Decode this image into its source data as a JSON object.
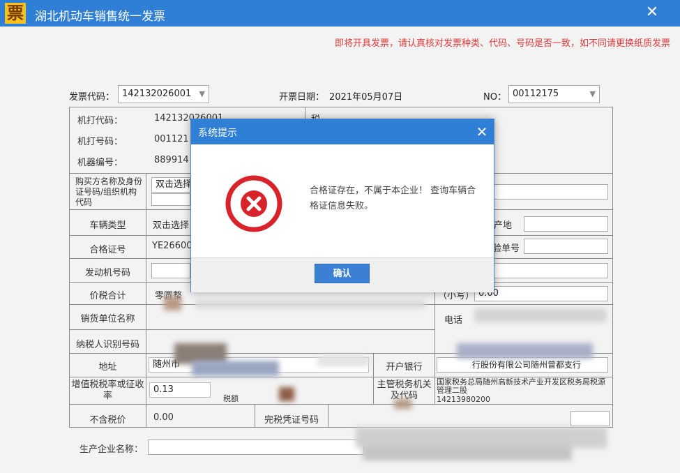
{
  "window": {
    "icon_glyph": "票",
    "title": "湖北机动车销售统一发票",
    "close_glyph": "✕"
  },
  "warning": "即将开具发票，请认真核对发票种类、代码、号码是否一致，如不同请更换纸质发票",
  "header": {
    "code_label": "发票代码：",
    "code_value": "142132026001",
    "date_label": "开票日期：",
    "date_value": "2021年05月07日",
    "no_label": "NO：",
    "no_value": "00112175"
  },
  "form": {
    "machine_code_label": "机打代码：",
    "machine_code_value": "142132026001",
    "machine_no_label": "机打号码：",
    "machine_no_value": "001121",
    "machine_id_label": "机器编号：",
    "machine_id_value": "889914",
    "tax_label_fragment": "税",
    "buyer_label": "购买方名称及身份证号码/组织机构代码",
    "buyer_placeholder": "双击选择",
    "vehicle_type_label": "车辆类型",
    "vehicle_type_placeholder": "双击选择",
    "origin_fragment": "产地",
    "cert_label": "合格证号",
    "cert_value": "YE26600",
    "inspection_fragment": "验单号",
    "engine_label": "发动机号码",
    "total_label": "价税合计",
    "total_upper": "零圆整",
    "total_small_label": "（小写）",
    "total_small_value": "0.00",
    "seller_label": "销货单位名称",
    "phone_label": "电话",
    "taxpayer_id_label": "纳税人识别号码",
    "address_label": "地址",
    "address_value": "随州市",
    "bank_label": "开户银行",
    "bank_value": "行股份有限公司随州曾都支行",
    "vat_rate_label": "增值税税率或征收率",
    "vat_rate_value": "0.13",
    "tax_amount_fragment": "税额",
    "tax_authority_label": "主管税务机关及代码",
    "tax_authority_value": "国家税务总局随州高新技术产业开发区税务局税源管理二股",
    "tax_authority_code": "14213980200",
    "excl_tax_label": "不含税价",
    "excl_tax_value": "0.00",
    "duty_cert_label": "完税凭证号码",
    "manufacturer_label": "生产企业名称："
  },
  "dialog": {
    "title": "系统提示",
    "close_glyph": "✕",
    "message": "合格证存在，不属于本企业！ 查询车辆合格证信息失败。",
    "ok_label": "确认",
    "icon": "error-icon"
  },
  "colors": {
    "titlebar": "#2f7fd6",
    "warning_text": "#e23a3a",
    "error_red": "#d9232a",
    "ok_button": "#3c80d3"
  }
}
